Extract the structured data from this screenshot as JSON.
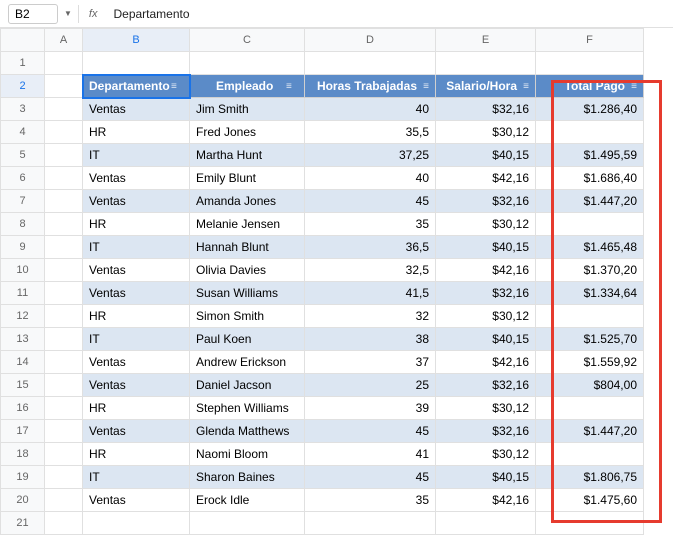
{
  "nameBox": "B2",
  "formulaBar": "Departamento",
  "columns": [
    "A",
    "B",
    "C",
    "D",
    "E",
    "F"
  ],
  "headers": {
    "B": "Departamento",
    "C": "Empleado",
    "D": "Horas Trabajadas",
    "E": "Salario/Hora",
    "F": "Total Pago"
  },
  "rows": [
    {
      "n": 3,
      "dep": "Ventas",
      "emp": "Jim Smith",
      "horas": "40",
      "sal": "$32,16",
      "total": "$1.286,40"
    },
    {
      "n": 4,
      "dep": "HR",
      "emp": "Fred Jones",
      "horas": "35,5",
      "sal": "$30,12",
      "total": ""
    },
    {
      "n": 5,
      "dep": "IT",
      "emp": "Martha Hunt",
      "horas": "37,25",
      "sal": "$40,15",
      "total": "$1.495,59"
    },
    {
      "n": 6,
      "dep": "Ventas",
      "emp": "Emily Blunt",
      "horas": "40",
      "sal": "$42,16",
      "total": "$1.686,40"
    },
    {
      "n": 7,
      "dep": "Ventas",
      "emp": "Amanda Jones",
      "horas": "45",
      "sal": "$32,16",
      "total": "$1.447,20"
    },
    {
      "n": 8,
      "dep": "HR",
      "emp": "Melanie Jensen",
      "horas": "35",
      "sal": "$30,12",
      "total": ""
    },
    {
      "n": 9,
      "dep": "IT",
      "emp": "Hannah Blunt",
      "horas": "36,5",
      "sal": "$40,15",
      "total": "$1.465,48"
    },
    {
      "n": 10,
      "dep": "Ventas",
      "emp": "Olivia Davies",
      "horas": "32,5",
      "sal": "$42,16",
      "total": "$1.370,20"
    },
    {
      "n": 11,
      "dep": "Ventas",
      "emp": "Susan Williams",
      "horas": "41,5",
      "sal": "$32,16",
      "total": "$1.334,64"
    },
    {
      "n": 12,
      "dep": "HR",
      "emp": "Simon Smith",
      "horas": "32",
      "sal": "$30,12",
      "total": ""
    },
    {
      "n": 13,
      "dep": "IT",
      "emp": "Paul Koen",
      "horas": "38",
      "sal": "$40,15",
      "total": "$1.525,70"
    },
    {
      "n": 14,
      "dep": "Ventas",
      "emp": "Andrew Erickson",
      "horas": "37",
      "sal": "$42,16",
      "total": "$1.559,92"
    },
    {
      "n": 15,
      "dep": "Ventas",
      "emp": "Daniel Jacson",
      "horas": "25",
      "sal": "$32,16",
      "total": "$804,00"
    },
    {
      "n": 16,
      "dep": "HR",
      "emp": "Stephen Williams",
      "horas": "39",
      "sal": "$30,12",
      "total": ""
    },
    {
      "n": 17,
      "dep": "Ventas",
      "emp": "Glenda Matthews",
      "horas": "45",
      "sal": "$32,16",
      "total": "$1.447,20"
    },
    {
      "n": 18,
      "dep": "HR",
      "emp": "Naomi Bloom",
      "horas": "41",
      "sal": "$30,12",
      "total": ""
    },
    {
      "n": 19,
      "dep": "IT",
      "emp": "Sharon Baines",
      "horas": "45",
      "sal": "$40,15",
      "total": "$1.806,75"
    },
    {
      "n": 20,
      "dep": "Ventas",
      "emp": "Erock Idle",
      "horas": "35",
      "sal": "$42,16",
      "total": "$1.475,60"
    }
  ],
  "chart_data": {
    "type": "table",
    "columns": [
      "Departamento",
      "Empleado",
      "Horas Trabajadas",
      "Salario/Hora",
      "Total Pago"
    ],
    "rows": [
      [
        "Ventas",
        "Jim Smith",
        40,
        32.16,
        1286.4
      ],
      [
        "HR",
        "Fred Jones",
        35.5,
        30.12,
        null
      ],
      [
        "IT",
        "Martha Hunt",
        37.25,
        40.15,
        1495.59
      ],
      [
        "Ventas",
        "Emily Blunt",
        40,
        42.16,
        1686.4
      ],
      [
        "Ventas",
        "Amanda Jones",
        45,
        32.16,
        1447.2
      ],
      [
        "HR",
        "Melanie Jensen",
        35,
        30.12,
        null
      ],
      [
        "IT",
        "Hannah Blunt",
        36.5,
        40.15,
        1465.48
      ],
      [
        "Ventas",
        "Olivia Davies",
        32.5,
        42.16,
        1370.2
      ],
      [
        "Ventas",
        "Susan Williams",
        41.5,
        32.16,
        1334.64
      ],
      [
        "HR",
        "Simon Smith",
        32,
        30.12,
        null
      ],
      [
        "IT",
        "Paul Koen",
        38,
        40.15,
        1525.7
      ],
      [
        "Ventas",
        "Andrew Erickson",
        37,
        42.16,
        1559.92
      ],
      [
        "Ventas",
        "Daniel Jacson",
        25,
        32.16,
        804.0
      ],
      [
        "HR",
        "Stephen Williams",
        39,
        30.12,
        null
      ],
      [
        "Ventas",
        "Glenda Matthews",
        45,
        32.16,
        1447.2
      ],
      [
        "HR",
        "Naomi Bloom",
        41,
        30.12,
        null
      ],
      [
        "IT",
        "Sharon Baines",
        45,
        40.15,
        1806.75
      ],
      [
        "Ventas",
        "Erock Idle",
        35,
        42.16,
        1475.6
      ]
    ]
  }
}
